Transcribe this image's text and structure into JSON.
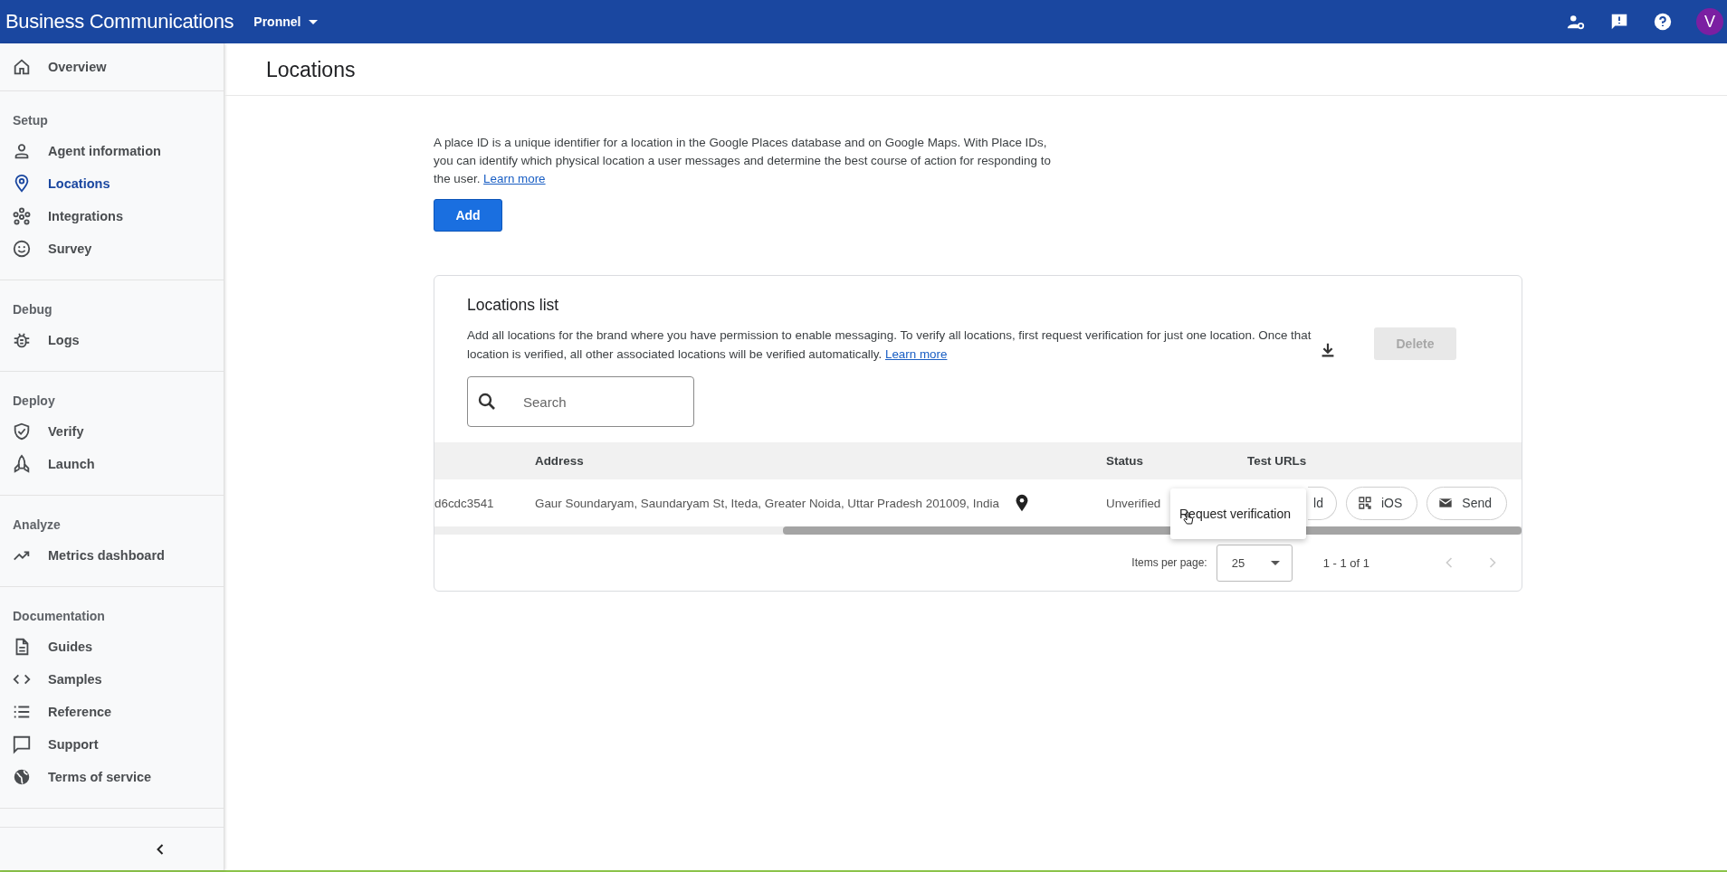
{
  "app_bar": {
    "title": "Business Communications",
    "account": "Pronnel",
    "avatar": "V"
  },
  "sidebar": {
    "groups": [
      {
        "items": [
          {
            "label": "Overview",
            "selected": false
          }
        ]
      },
      {
        "heading": "Setup",
        "items": [
          {
            "label": "Agent information",
            "selected": false
          },
          {
            "label": "Locations",
            "selected": true
          },
          {
            "label": "Integrations",
            "selected": false
          },
          {
            "label": "Survey",
            "selected": false
          }
        ]
      },
      {
        "heading": "Debug",
        "items": [
          {
            "label": "Logs",
            "selected": false
          }
        ]
      },
      {
        "heading": "Deploy",
        "items": [
          {
            "label": "Verify",
            "selected": false
          },
          {
            "label": "Launch",
            "selected": false
          }
        ]
      },
      {
        "heading": "Analyze",
        "items": [
          {
            "label": "Metrics dashboard",
            "selected": false
          }
        ]
      },
      {
        "heading": "Documentation",
        "items": [
          {
            "label": "Guides",
            "selected": false
          },
          {
            "label": "Samples",
            "selected": false
          },
          {
            "label": "Reference",
            "selected": false
          },
          {
            "label": "Support",
            "selected": false
          },
          {
            "label": "Terms of service",
            "selected": false
          }
        ]
      }
    ]
  },
  "page_title": "Locations",
  "intro": {
    "text": "A place ID is a unique identifier for a location in the Google Places database and on Google Maps. With Place IDs, you can identify which physical location a user messages and determine the best course of action for responding to the user.",
    "link": "Learn more"
  },
  "add_button": "Add",
  "locations_card": {
    "title": "Locations list",
    "description": "Add all locations for the brand where you have permission to enable messaging. To verify all locations, first request verification for just one location. Once that location is verified, all other associated locations will be verified automatically.",
    "link": "Learn more",
    "delete_button": {
      "label": "Delete",
      "disabled": true
    },
    "search": {
      "placeholder": "Search"
    },
    "columns": [
      "Address",
      "Status",
      "Test URLs"
    ],
    "rows": [
      {
        "column_1": "d6cdc3541",
        "address": "Gaur Soundaryam, Saundaryam St, Iteda, Greater Noida, Uttar Pradesh 201009, India",
        "status": "Unverified",
        "test_urls": [
          "ld",
          "iOS",
          "Send"
        ]
      }
    ],
    "menu": {
      "items": [
        "Request verification"
      ]
    },
    "paginator": {
      "label": "Items per page:",
      "page_size": "25",
      "range": "1 - 1 of 1",
      "previous": {
        "disabled": true
      },
      "next": {
        "disabled": true
      }
    }
  }
}
